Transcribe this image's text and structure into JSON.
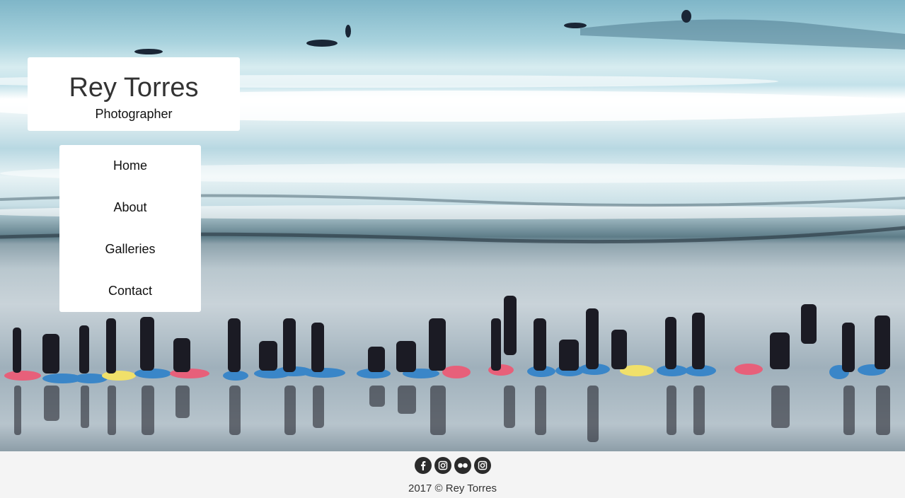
{
  "brand": {
    "name": "Rey Torres",
    "tagline": "Photographer"
  },
  "nav": {
    "items": [
      {
        "label": "Home"
      },
      {
        "label": "About"
      },
      {
        "label": "Galleries"
      },
      {
        "label": "Contact"
      }
    ]
  },
  "hero": {
    "image": "beach-surf-lesson-photo"
  },
  "footer": {
    "social_icons": [
      "facebook-icon",
      "instagram-icon",
      "flickr-icon",
      "instagram-icon"
    ],
    "copyright": "2017 © Rey Torres"
  },
  "colors": {
    "panel": "#ffffff",
    "footer_bg": "#f4f4f4",
    "social_bg": "#2b2b2b",
    "text": "#333333"
  }
}
